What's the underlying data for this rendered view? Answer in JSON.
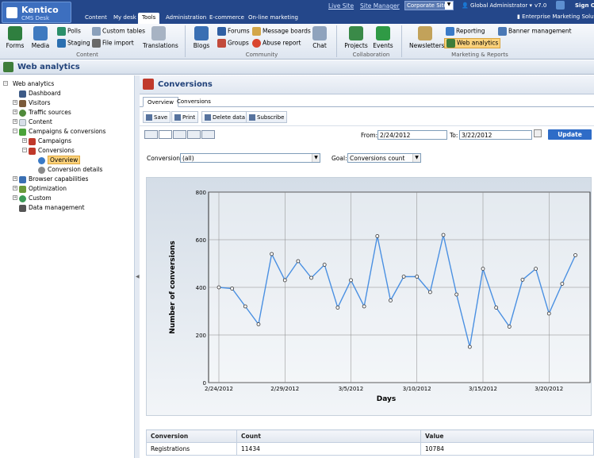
{
  "app": {
    "logo_title": "Kentico",
    "logo_subtitle": "CMS Desk"
  },
  "top_nav": {
    "tabs": [
      {
        "label": "Content"
      },
      {
        "label": "My desk"
      },
      {
        "label": "Tools"
      },
      {
        "label": "Administration"
      },
      {
        "label": "E-commerce"
      },
      {
        "label": "On-line marketing"
      }
    ],
    "active_tab": "Tools",
    "live_site": "Live Site",
    "site_manager": "Site Manager",
    "site_selector": "Corporate Site",
    "user": "Global Administrator",
    "version": "v7.0",
    "sign_out": "Sign Out",
    "license": "Enterprise Marketing Solution"
  },
  "ribbon": {
    "groups": [
      {
        "name": "Content"
      },
      {
        "name": "Community"
      },
      {
        "name": "Collaboration"
      },
      {
        "name": "Marketing & Reports"
      }
    ],
    "buttons": {
      "forms": "Forms",
      "media": "Media",
      "polls": "Polls",
      "staging": "Staging",
      "custom_tables": "Custom tables",
      "file_import": "File import",
      "translations": "Translations",
      "blogs": "Blogs",
      "forums": "Forums",
      "groups": "Groups",
      "message_boards": "Message boards",
      "abuse_report": "Abuse report",
      "chat": "Chat",
      "projects": "Projects",
      "events": "Events",
      "newsletters": "Newsletters",
      "reporting": "Reporting",
      "web_analytics": "Web analytics",
      "banner_management": "Banner management"
    }
  },
  "page_header": {
    "title": "Web analytics"
  },
  "tree": {
    "items": [
      {
        "label": "Web analytics"
      },
      {
        "label": "Dashboard"
      },
      {
        "label": "Visitors"
      },
      {
        "label": "Traffic sources"
      },
      {
        "label": "Content"
      },
      {
        "label": "Campaigns & conversions"
      },
      {
        "label": "Campaigns"
      },
      {
        "label": "Conversions"
      },
      {
        "label": "Overview"
      },
      {
        "label": "Conversion details"
      },
      {
        "label": "Browser capabilities"
      },
      {
        "label": "Optimization"
      },
      {
        "label": "Custom"
      },
      {
        "label": "Data management"
      }
    ],
    "selected": "Overview"
  },
  "content": {
    "title": "Conversions",
    "tabs": [
      {
        "label": "Overview"
      },
      {
        "label": "Conversions"
      }
    ],
    "toolbar": {
      "save": "Save",
      "print": "Print",
      "delete_data": "Delete data",
      "subscribe": "Subscribe"
    },
    "from_label": "From:",
    "from_value": "2/24/2012",
    "to_label": "To:",
    "to_value": "3/22/2012",
    "update": "Update",
    "conversion_label": "Conversion:",
    "conversion_value": "(all)",
    "goal_label": "Goal:",
    "goal_value": "Conversions count"
  },
  "chart_data": {
    "type": "line",
    "xlabel": "Days",
    "ylabel": "Number of conversions",
    "x": [
      "2/24/2012",
      "2/25/2012",
      "2/26/2012",
      "2/27/2012",
      "2/28/2012",
      "2/29/2012",
      "3/1/2012",
      "3/2/2012",
      "3/3/2012",
      "3/4/2012",
      "3/5/2012",
      "3/6/2012",
      "3/7/2012",
      "3/8/2012",
      "3/9/2012",
      "3/10/2012",
      "3/11/2012",
      "3/12/2012",
      "3/13/2012",
      "3/14/2012",
      "3/15/2012",
      "3/16/2012",
      "3/17/2012",
      "3/18/2012",
      "3/19/2012",
      "3/20/2012",
      "3/21/2012",
      "3/22/2012"
    ],
    "values": [
      400,
      395,
      320,
      245,
      540,
      430,
      510,
      440,
      495,
      315,
      430,
      320,
      615,
      345,
      445,
      445,
      380,
      620,
      370,
      150,
      478,
      315,
      235,
      432,
      478,
      290,
      415,
      535
    ],
    "ylim": [
      0,
      800
    ],
    "yticks": [
      0,
      200,
      400,
      600,
      800
    ],
    "xticks": [
      "2/24/2012",
      "2/29/2012",
      "3/5/2012",
      "3/10/2012",
      "3/15/2012",
      "3/20/2012"
    ],
    "grid": true,
    "color": "#4a90e2"
  },
  "table": {
    "headers": [
      "Conversion",
      "Count",
      "Value"
    ],
    "rows": [
      [
        "Registrations",
        "11434",
        "10784"
      ]
    ]
  },
  "colors": {
    "top_bar": "#24478a",
    "accent": "#2e6cc7",
    "selected": "#fbd27c"
  }
}
